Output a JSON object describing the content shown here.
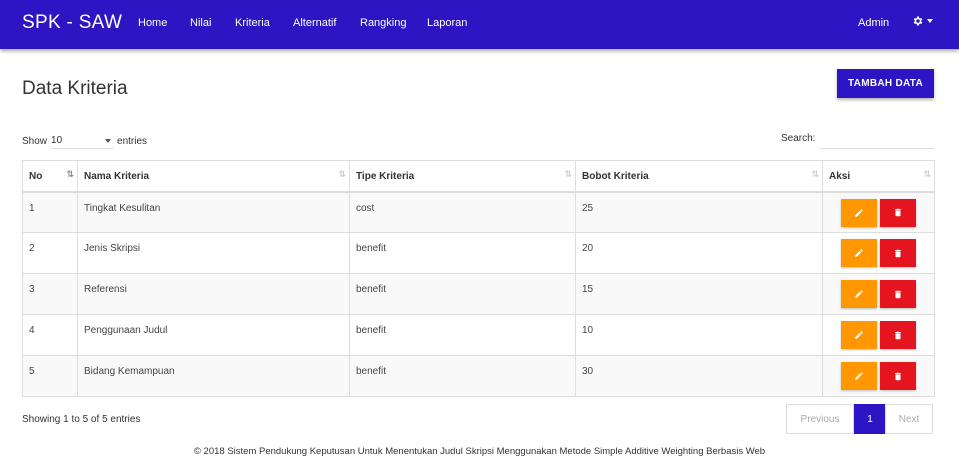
{
  "navbar": {
    "brand": "SPK - SAW",
    "items": [
      "Home",
      "Nilai",
      "Kriteria",
      "Alternatif",
      "Rangking",
      "Laporan"
    ],
    "user": "Admin",
    "color": "#2d15c4"
  },
  "page": {
    "title": "Data Kriteria",
    "add_button": "TAMBAH DATA"
  },
  "controls": {
    "show_label": "Show",
    "length_value": "10",
    "entries_label": "entries",
    "search_label": "Search:"
  },
  "table": {
    "headers": [
      "No",
      "Nama Kriteria",
      "Tipe Kriteria",
      "Bobot Kriteria",
      "Aksi"
    ],
    "rows": [
      [
        "1",
        "Tingkat Kesulitan",
        "cost",
        "25"
      ],
      [
        "2",
        "Jenis Skripsi",
        "benefit",
        "20"
      ],
      [
        "3",
        "Referensi",
        "benefit",
        "15"
      ],
      [
        "4",
        "Penggunaan Judul",
        "benefit",
        "10"
      ],
      [
        "5",
        "Bidang Kemampuan",
        "benefit",
        "30"
      ]
    ]
  },
  "info": "Showing 1 to 5 of 5 entries",
  "pagination": {
    "previous": "Previous",
    "current": "1",
    "next": "Next"
  },
  "footer": "© 2018 Sistem Pendukung Keputusan Untuk Menentukan Judul Skripsi Menggunakan Metode Simple Additive Weighting Berbasis Web",
  "colors": {
    "primary": "#2d15c4",
    "edit": "#ff9800",
    "delete": "#e4151f"
  }
}
